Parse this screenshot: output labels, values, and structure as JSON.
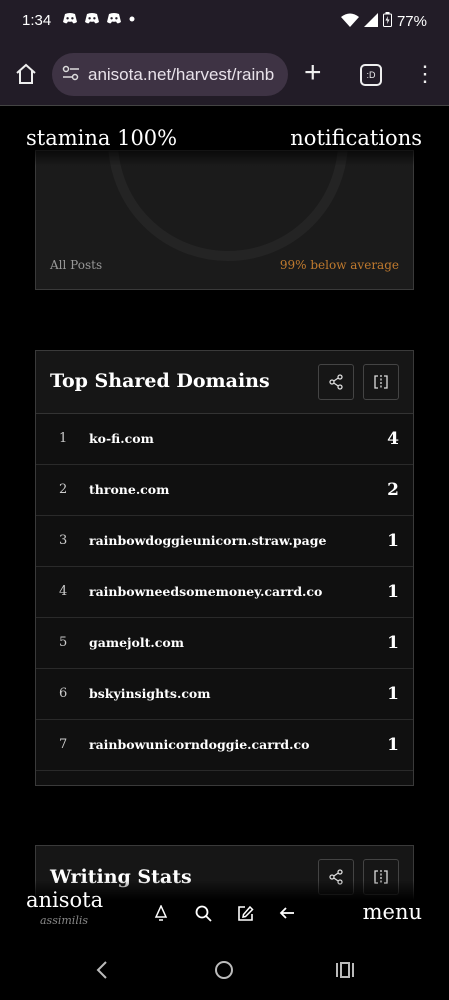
{
  "status": {
    "time": "1:34",
    "battery": "77%"
  },
  "browser": {
    "url": "anisota.net/harvest/rainb"
  },
  "header": {
    "stamina": "stamina 100%",
    "notifications": "notifications"
  },
  "top_card": {
    "left_label": "All Posts",
    "right_label": "99% below average"
  },
  "domains_card": {
    "title": "Top Shared Domains",
    "rows": [
      {
        "rank": "1",
        "domain": "ko-fi.com",
        "count": "4"
      },
      {
        "rank": "2",
        "domain": "throne.com",
        "count": "2"
      },
      {
        "rank": "3",
        "domain": "rainbowdoggieunicorn.straw.page",
        "count": "1"
      },
      {
        "rank": "4",
        "domain": "rainbowneedsomemoney.carrd.co",
        "count": "1"
      },
      {
        "rank": "5",
        "domain": "gamejolt.com",
        "count": "1"
      },
      {
        "rank": "6",
        "domain": "bskyinsights.com",
        "count": "1"
      },
      {
        "rank": "7",
        "domain": "rainbowunicorndoggie.carrd.co",
        "count": "1"
      }
    ]
  },
  "writing_card": {
    "title": "Writing Stats"
  },
  "bottom_nav": {
    "brand": "anisota",
    "brand_sub": "assimilis",
    "menu": "menu"
  },
  "colors": {
    "accent_orange": "#c07a2e",
    "chrome_bg": "#221c27"
  }
}
